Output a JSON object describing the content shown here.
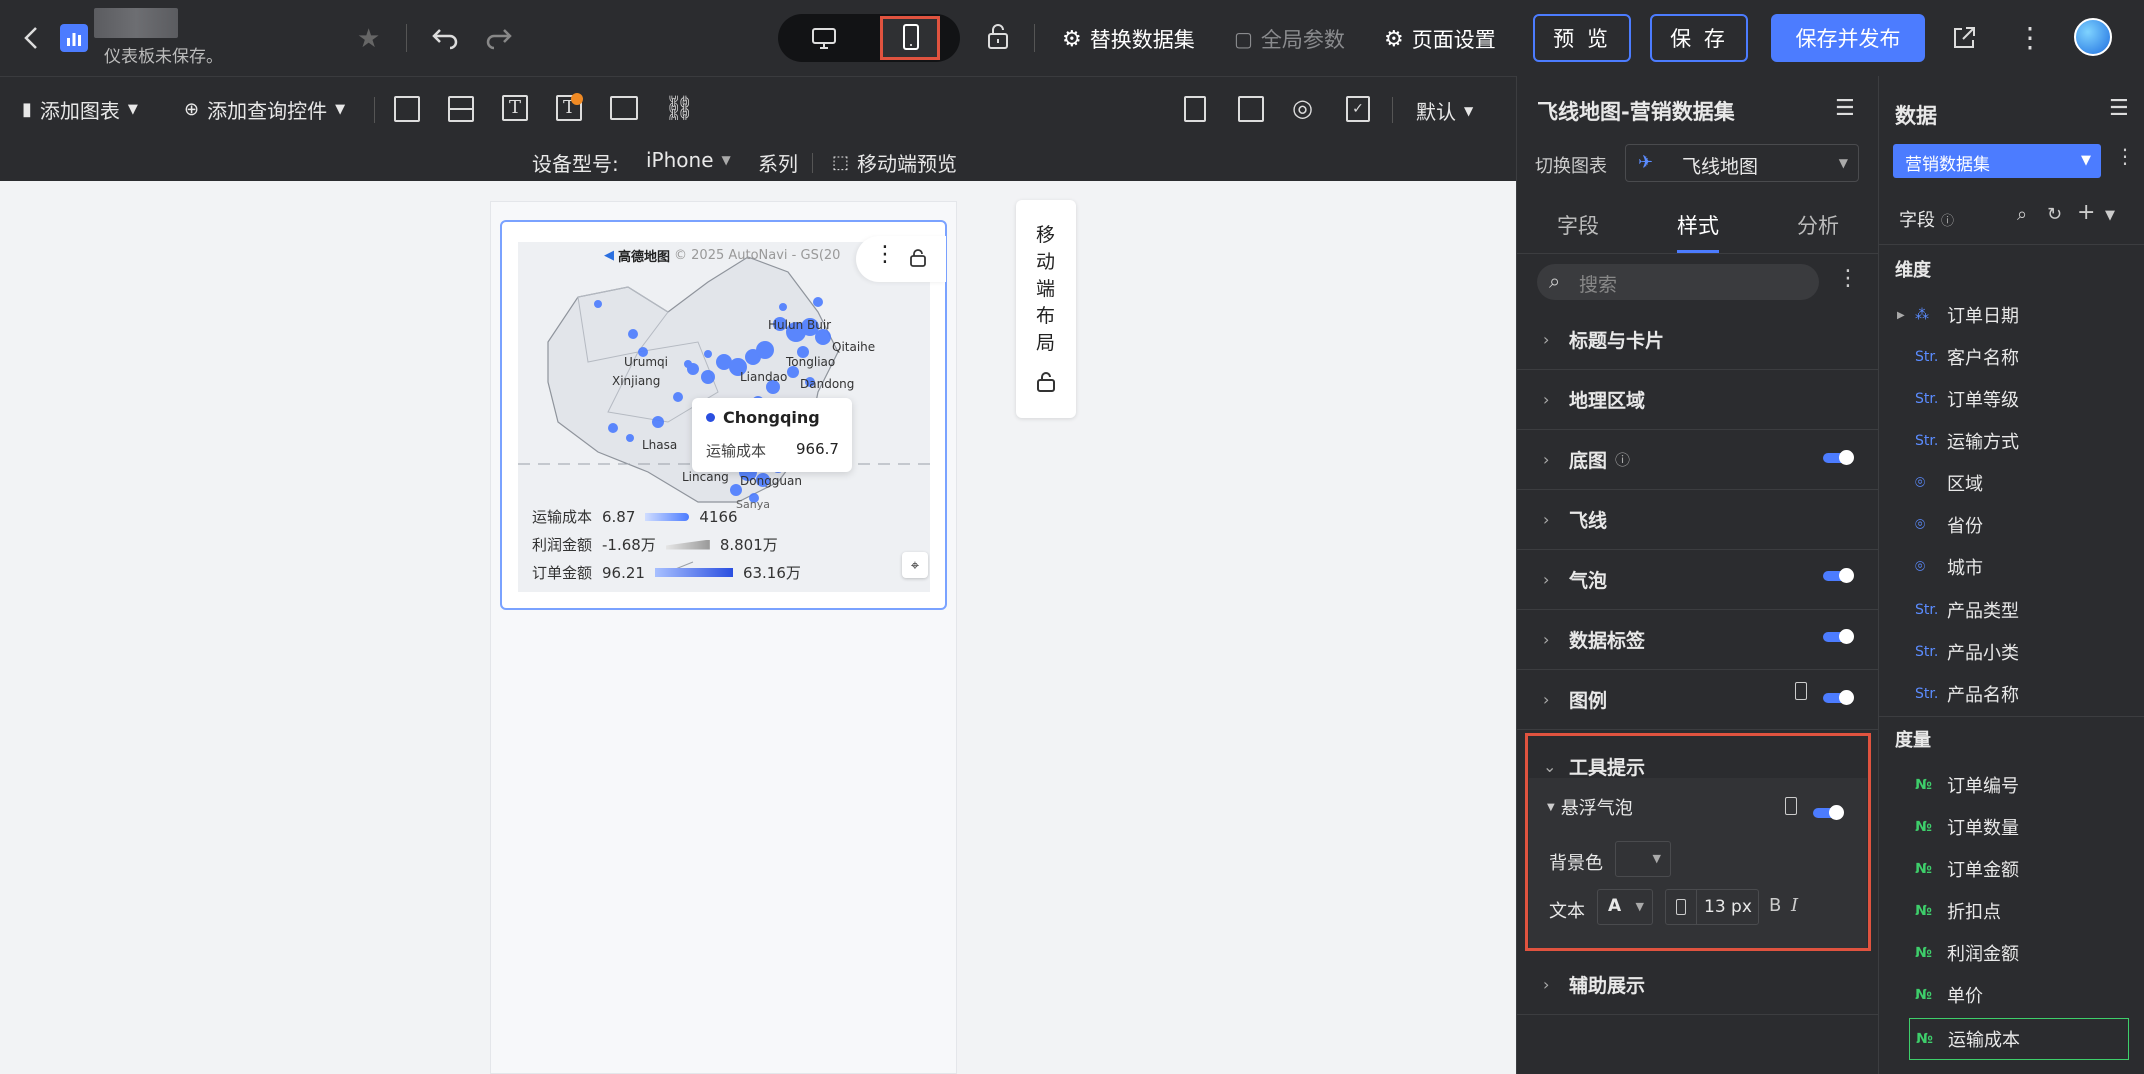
{
  "topbar": {
    "subtitle": "仪表板未保存。",
    "replace_dataset": "替换数据集",
    "global_params": "全局参数",
    "page_settings": "页面设置",
    "preview": "预 览",
    "save": "保 存",
    "save_publish": "保存并发布"
  },
  "toolbar": {
    "add_chart": "添加图表",
    "add_query": "添加查询控件",
    "default_label": "默认"
  },
  "device": {
    "label": "设备型号:",
    "model": "iPhone",
    "series": "系列",
    "mobile_preview": "移动端预览"
  },
  "mobile_layout": {
    "label": "移动端布局",
    "chars": [
      "移",
      "动",
      "端",
      "布",
      "局"
    ]
  },
  "map": {
    "attribution": "高德地图",
    "copyright": "© 2025 AutoNavi - GS(20",
    "places": [
      "Hulun Buir",
      "Qitaihe",
      "Urumqi",
      "Xinjiang",
      "Liandao",
      "Tongliao",
      "Dandong",
      "Lhasa",
      "Lincang",
      "Dongguan",
      "Sanya"
    ],
    "tooltip": {
      "city": "Chongqing",
      "metric": "运输成本",
      "value": "966.7"
    },
    "legend": [
      {
        "name": "运输成本",
        "min": "6.87",
        "max": "4166",
        "color": "#4c7cff"
      },
      {
        "name": "利润金额",
        "min": "-1.68万",
        "max": "8.801万",
        "color": "#999999"
      },
      {
        "name": "订单金额",
        "min": "96.21",
        "max": "63.16万",
        "color": "#2a4fe0"
      }
    ]
  },
  "style_panel": {
    "title": "飞线地图-营销数据集",
    "switch_chart_label": "切换图表",
    "chart_type": "飞线地图",
    "tabs": [
      "字段",
      "样式",
      "分析"
    ],
    "active_tab": "样式",
    "search_placeholder": "搜索",
    "sections": [
      "标题与卡片",
      "地理区域",
      "底图",
      "飞线",
      "气泡",
      "数据标签",
      "图例",
      "工具提示",
      "辅助展示"
    ],
    "tooltip_sub": "悬浮气泡",
    "bg_color_label": "背景色",
    "text_label": "文本",
    "font_letter": "A",
    "font_size": "13 px",
    "bold": "B",
    "italic": "I",
    "accent": "#4c7cff",
    "highlight": "#e0533f"
  },
  "data_panel": {
    "title": "数据",
    "dataset": "营销数据集",
    "fields_label": "字段",
    "dimensions_label": "维度",
    "measures_label": "度量",
    "dimensions": [
      {
        "type": "date",
        "name": "订单日期"
      },
      {
        "type": "Str.",
        "name": "客户名称"
      },
      {
        "type": "Str.",
        "name": "订单等级"
      },
      {
        "type": "Str.",
        "name": "运输方式"
      },
      {
        "type": "geo",
        "name": "区域"
      },
      {
        "type": "geo",
        "name": "省份"
      },
      {
        "type": "geo",
        "name": "城市"
      },
      {
        "type": "Str.",
        "name": "产品类型"
      },
      {
        "type": "Str.",
        "name": "产品小类"
      },
      {
        "type": "Str.",
        "name": "产品名称"
      }
    ],
    "measures": [
      {
        "type": "№",
        "name": "订单编号"
      },
      {
        "type": "№",
        "name": "订单数量"
      },
      {
        "type": "№",
        "name": "订单金额"
      },
      {
        "type": "№",
        "name": "折扣点"
      },
      {
        "type": "№",
        "name": "利润金额"
      },
      {
        "type": "№",
        "name": "单价"
      },
      {
        "type": "№",
        "name": "运输成本"
      }
    ]
  }
}
